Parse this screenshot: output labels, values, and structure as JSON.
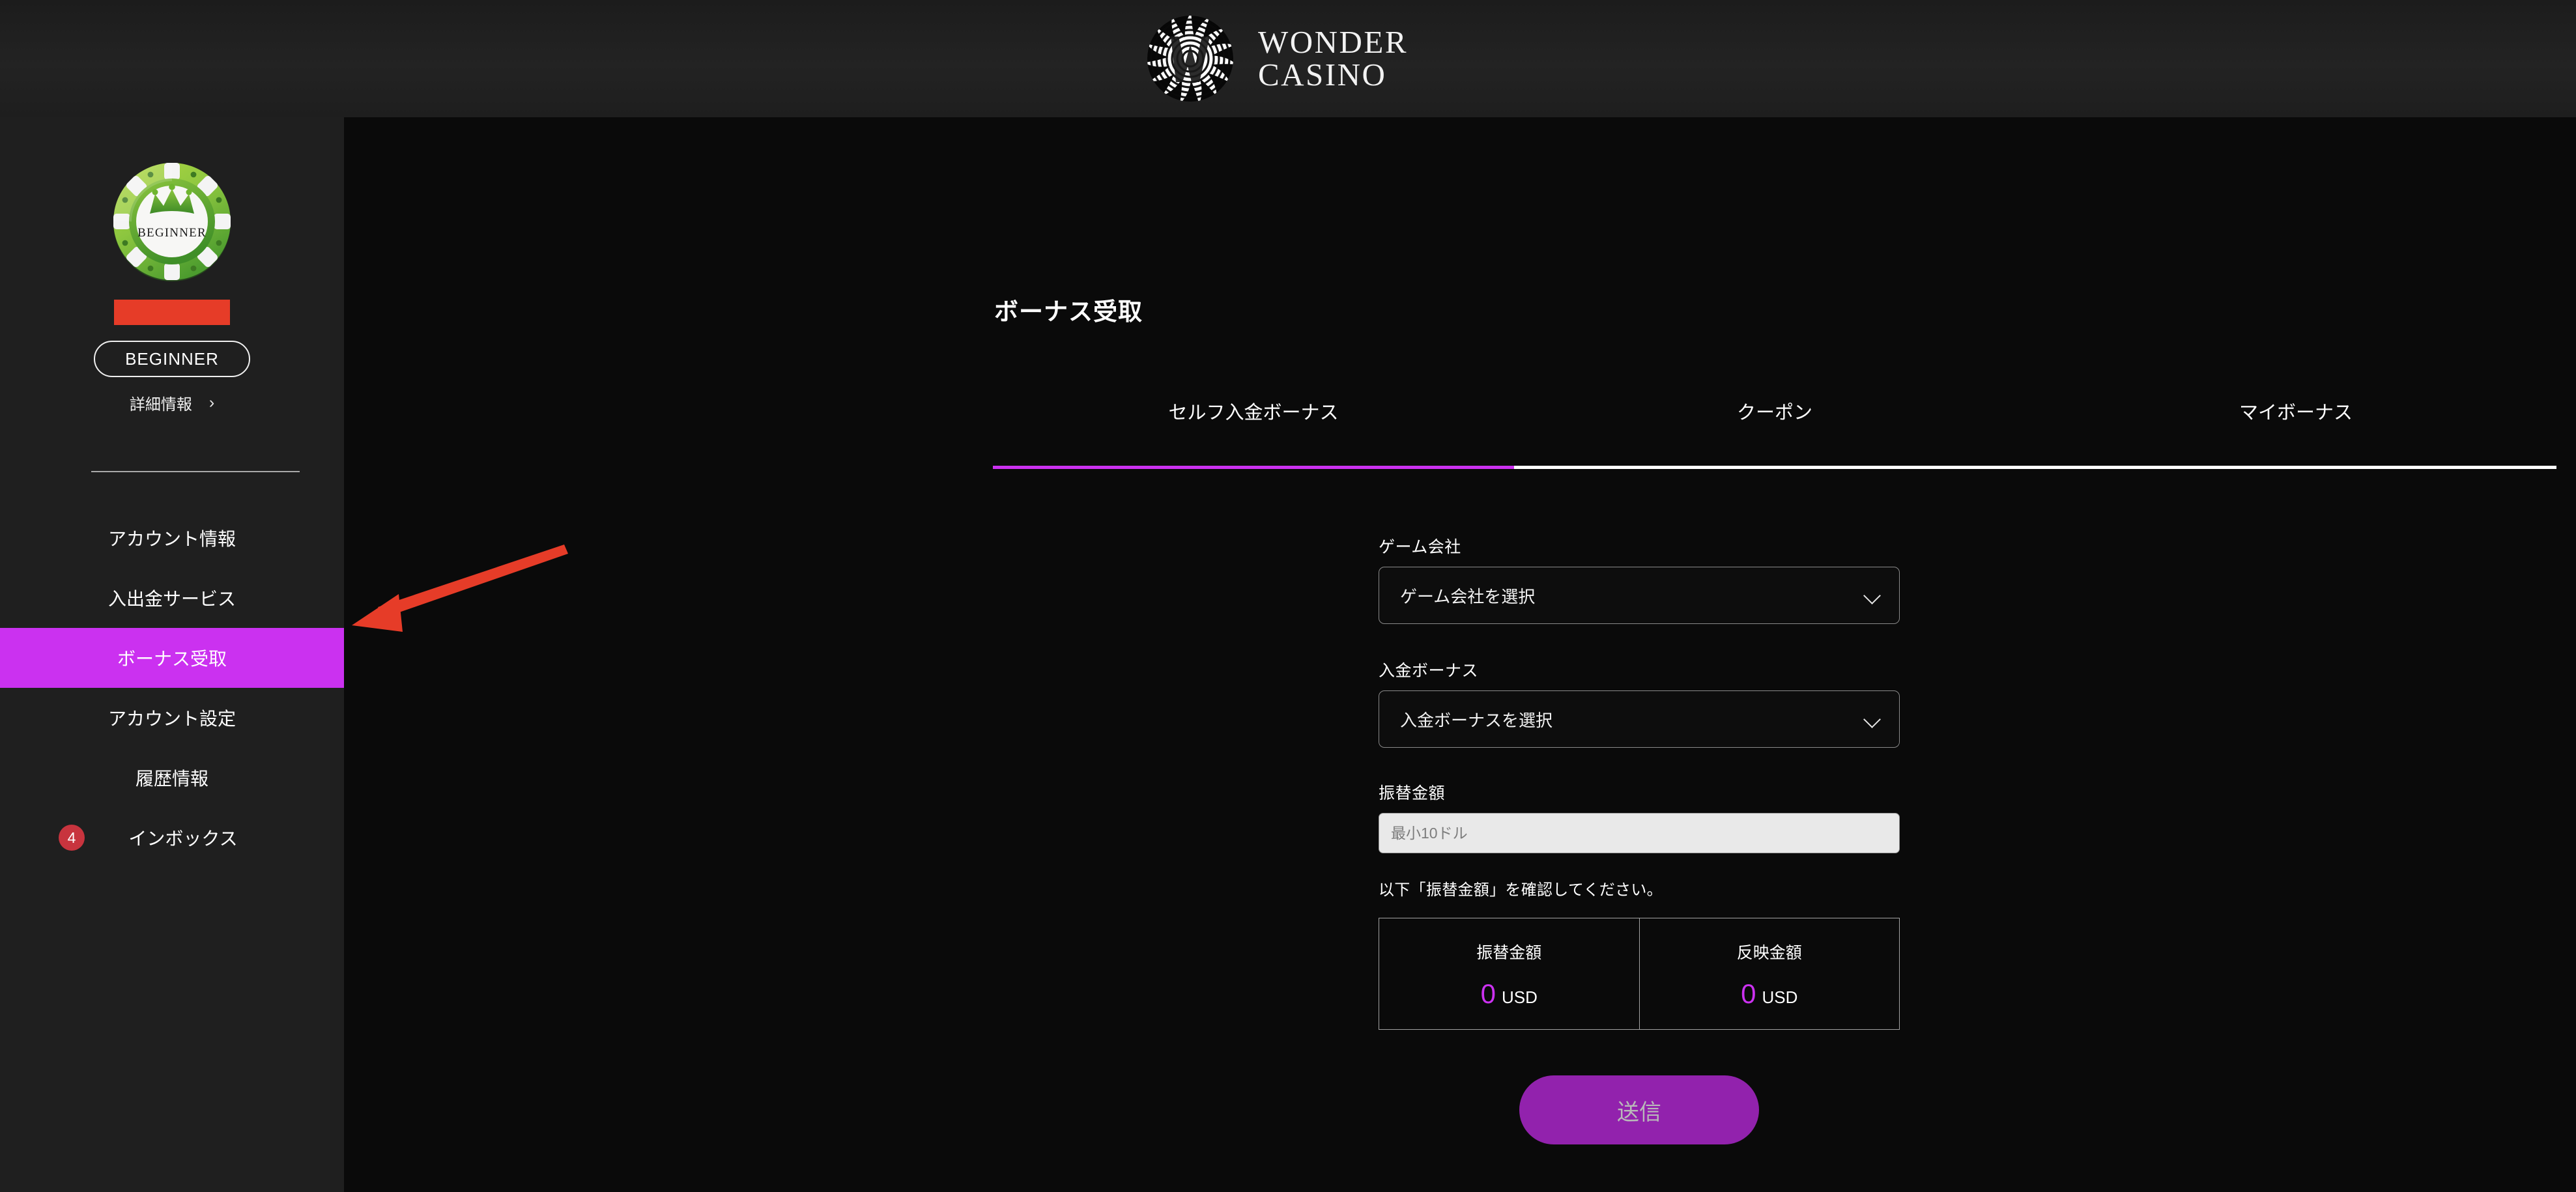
{
  "header": {
    "brand_line1": "WONDER",
    "brand_line2": "CASINO",
    "logo_icon": "wonder-casino-spiral-logo"
  },
  "sidebar": {
    "avatar_icon": "beginner-casino-chip-avatar",
    "avatar_chip_label": "BEGINNER",
    "username_redacted": "",
    "rank_badge": "BEGINNER",
    "detail_link": "詳細情報",
    "detail_chevron": "›",
    "items": [
      {
        "label": "アカウント情報",
        "active": false,
        "badge": ""
      },
      {
        "label": "入出金サービス",
        "active": false,
        "badge": ""
      },
      {
        "label": "ボーナス受取",
        "active": true,
        "badge": ""
      },
      {
        "label": "アカウント設定",
        "active": false,
        "badge": ""
      },
      {
        "label": "履歴情報",
        "active": false,
        "badge": ""
      },
      {
        "label": "インボックス",
        "active": false,
        "badge": "4"
      }
    ]
  },
  "main": {
    "page_title": "ボーナス受取",
    "tabs": [
      {
        "label": "セルフ入金ボーナス",
        "active": true
      },
      {
        "label": "クーポン",
        "active": false
      },
      {
        "label": "マイボーナス",
        "active": false
      }
    ],
    "form": {
      "game_company_label": "ゲーム会社",
      "game_company_value": "ゲーム会社を選択",
      "deposit_bonus_label": "入金ボーナス",
      "deposit_bonus_value": "入金ボーナスを選択",
      "transfer_amount_label": "振替金額",
      "transfer_amount_value": "",
      "transfer_amount_placeholder": "最小10ドル",
      "confirm_note": "以下「振替金額」を確認してください。",
      "summary": [
        {
          "caption": "振替金額",
          "number": "0",
          "currency": "USD"
        },
        {
          "caption": "反映金額",
          "number": "0",
          "currency": "USD"
        }
      ],
      "submit_label": "送信"
    }
  },
  "annotation": {
    "arrow_icon": "red-arrow-pointing-to-bonus-menu",
    "arrow_color": "#e63c28"
  },
  "colors": {
    "accent_magenta": "#cb31f0",
    "submit_purple": "#9222ad",
    "badge_red": "#c8343e",
    "redaction_red": "#e63c28",
    "sidebar_bg": "#1f1f1f",
    "content_bg": "#0a0a0a"
  }
}
